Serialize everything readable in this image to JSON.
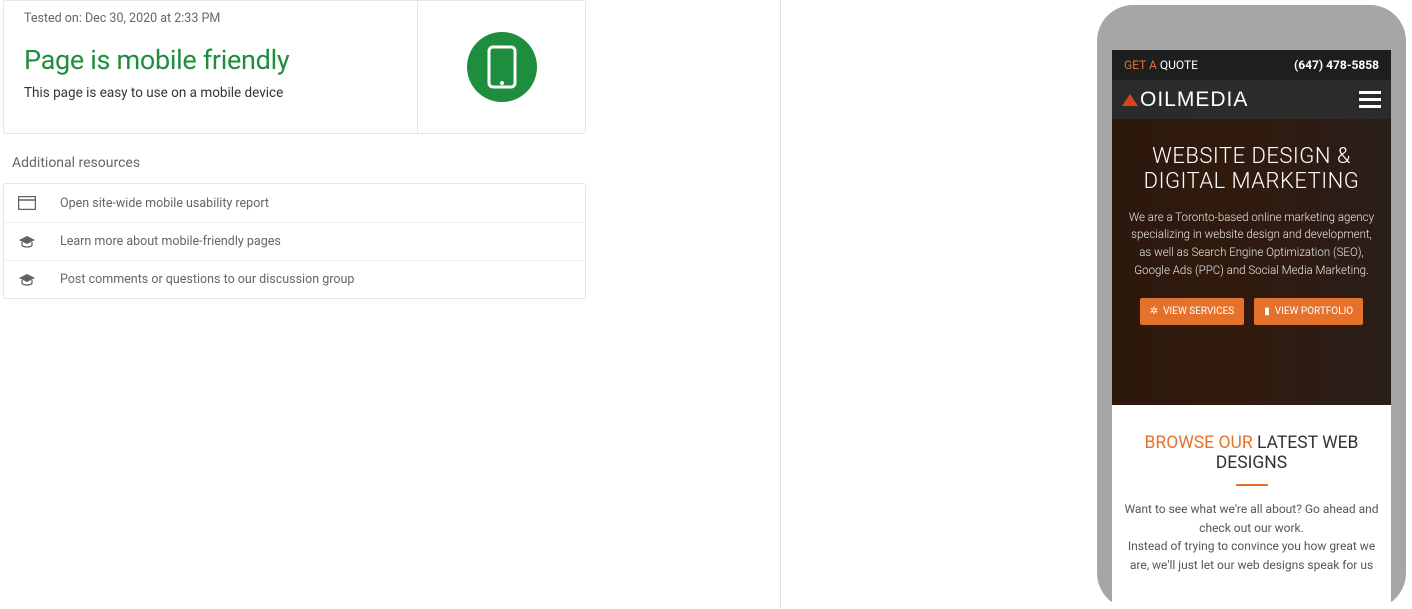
{
  "result": {
    "tested_on": "Tested on: Dec 30, 2020 at 2:33 PM",
    "title": "Page is mobile friendly",
    "subtitle": "This page is easy to use on a mobile device"
  },
  "additional_label": "Additional resources",
  "resources": [
    {
      "label": "Open site-wide mobile usability report"
    },
    {
      "label": "Learn more about mobile-friendly pages"
    },
    {
      "label": "Post comments or questions to our discussion group"
    }
  ],
  "phone": {
    "get_a": "GET A",
    "quote": "QUOTE",
    "phone_number": "(647) 478-5858",
    "logo_text": "OILMEDIA",
    "hero_title_1": "WEBSITE DESIGN &",
    "hero_title_2": "DIGITAL MARKETING",
    "hero_desc": "We are a Toronto-based online marketing agency specializing in website design and development, as well as Search Engine Optimization (SEO), Google Ads (PPC) and Social Media Marketing.",
    "btn_services": "VIEW SERVICES",
    "btn_portfolio": "VIEW PORTFOLIO",
    "browse_accent": "BROWSE OUR",
    "browse_rest": " LATEST WEB DESIGNS",
    "browse_p1": "Want to see what we're all about? Go ahead and check out our work.",
    "browse_p2": "Instead of trying to convince you how great we are, we'll just let our web designs speak for us"
  }
}
